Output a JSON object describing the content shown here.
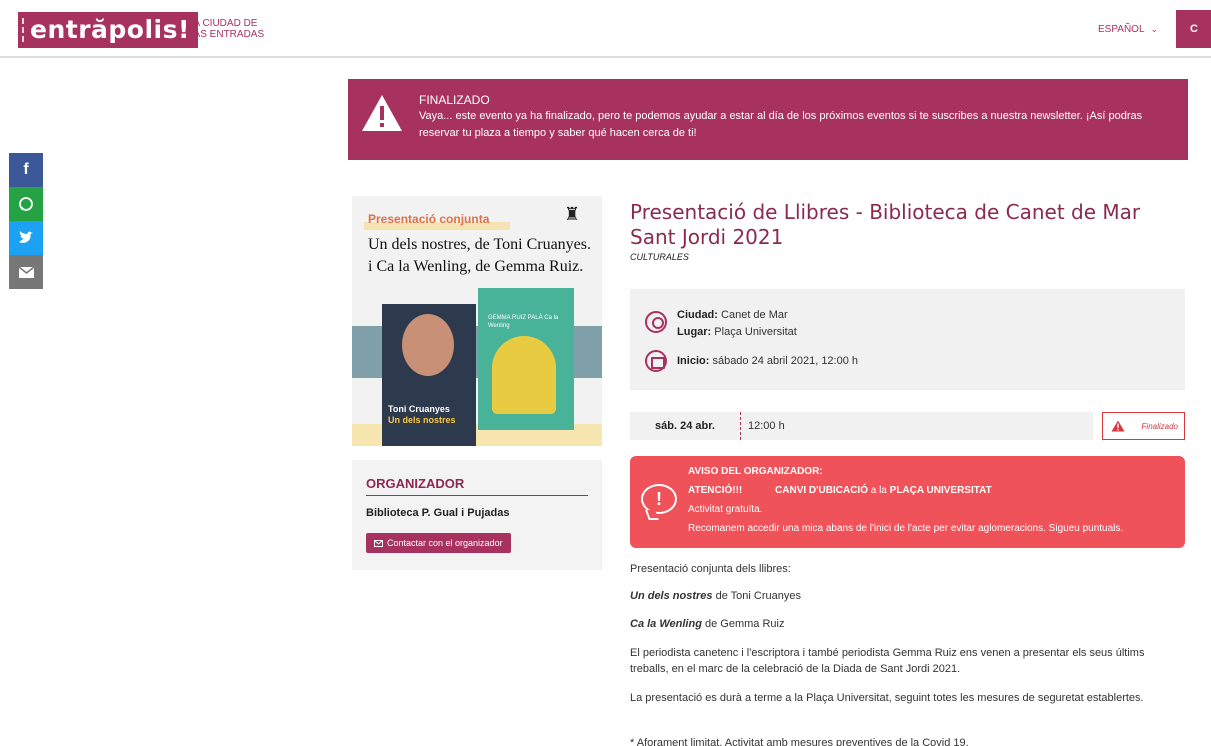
{
  "header": {
    "logo": "entrăpolis!",
    "tagline_1": "LA CIUDAD DE",
    "tagline_2": "LAS ENTRADAS",
    "language": "ESPAÑOL",
    "cta_partial": "C"
  },
  "social": [
    "f",
    "w",
    "t",
    "e"
  ],
  "banner": {
    "title": "FINALIZADO",
    "text": "Vaya... este evento ya ha finalizado, pero te podemos ayudar a estar al día de los próximos eventos si te suscribes a nuestra newsletter. ¡Así podras reservar tu plaza a tiempo y saber qué hacen cerca de ti!"
  },
  "poster": {
    "tag": "Presentació conjunta",
    "line_1": "Un dels nostres, de Toni Cruanyes.",
    "line_2": "i Ca la Wenling, de Gemma Ruiz.",
    "book1_author": "Toni Cruanyes",
    "book1_title": "Un dels nostres",
    "book2_text": "GEMMA RUIZ PALÀ Ca la Wenling"
  },
  "organizer": {
    "heading": "ORGANIZADOR",
    "name": "Biblioteca P. Gual i Pujadas",
    "contact": "Contactar con el organizador"
  },
  "event": {
    "title_1": "Presentació de Llibres - Biblioteca de Canet de Mar",
    "title_2": "Sant Jordi 2021",
    "category": "CULTURALES",
    "city_label": "Ciudad:",
    "city": "Canet de Mar",
    "place_label": "Lugar:",
    "place": "Plaça Universitat",
    "start_label": "Inicio:",
    "start": "sábado 24 abril 2021, 12:00 h",
    "date_short": "sáb. 24 abr.",
    "time": "12:00 h",
    "status": "Finalizado"
  },
  "aviso": {
    "title": "AVISO DEL ORGANIZADOR:",
    "atencio": "ATENCIÓ!!!",
    "canvi": "CANVI D'UBICACIÓ",
    "a_la": "a la",
    "plaza": "PLAÇA UNIVERSITAT",
    "line_2": "Activitat gratuïta.",
    "line_3": "Recomanem accedir una mica abans de l'inici de l'acte per evitar aglomeracions. Sigueu puntuals."
  },
  "description": {
    "p1": "Presentació conjunta dels llibres:",
    "book1_title": "Un dels nostres",
    "book1_rest": " de Toni Cruanyes",
    "book2_title": "Ca la Wenling",
    "book2_rest": " de Gemma Ruiz",
    "p4": "El periodista canetenc i l'escriptora i també periodista Gemma Ruiz ens venen a presentar els seus últims treballs, en el marc de la celebració de la Diada de Sant Jordi 2021.",
    "p5": "La presentació es durà a terme a la Plaça Universitat, seguint totes les mesures de seguretat establertes.",
    "p6": "* Aforament limitat. Activitat amb mesures preventives de la Covid 19."
  },
  "colors": {
    "brand": "#a8325f",
    "alert": "#f0525a",
    "status_red": "#d9363e"
  }
}
